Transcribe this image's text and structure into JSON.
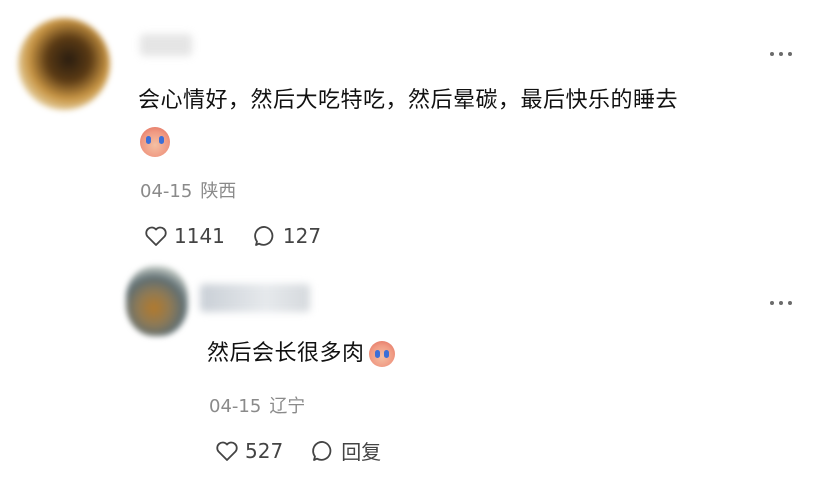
{
  "comment": {
    "username": "",
    "text": "会心情好，然后大吃特吃，然后晕碳，最后快乐的睡去",
    "emoji": "crying-face-emoji",
    "date": "04-15",
    "location": "陕西",
    "likes": "1141",
    "replies": "127"
  },
  "reply": {
    "username": "",
    "text": "然后会长很多肉",
    "emoji": "crying-face-emoji",
    "date": "04-15",
    "location": "辽宁",
    "likes": "527",
    "reply_label": "回复"
  },
  "colors": {
    "meta_text": "#8a8a8a",
    "body_text": "#111111",
    "action_text": "#444444"
  }
}
